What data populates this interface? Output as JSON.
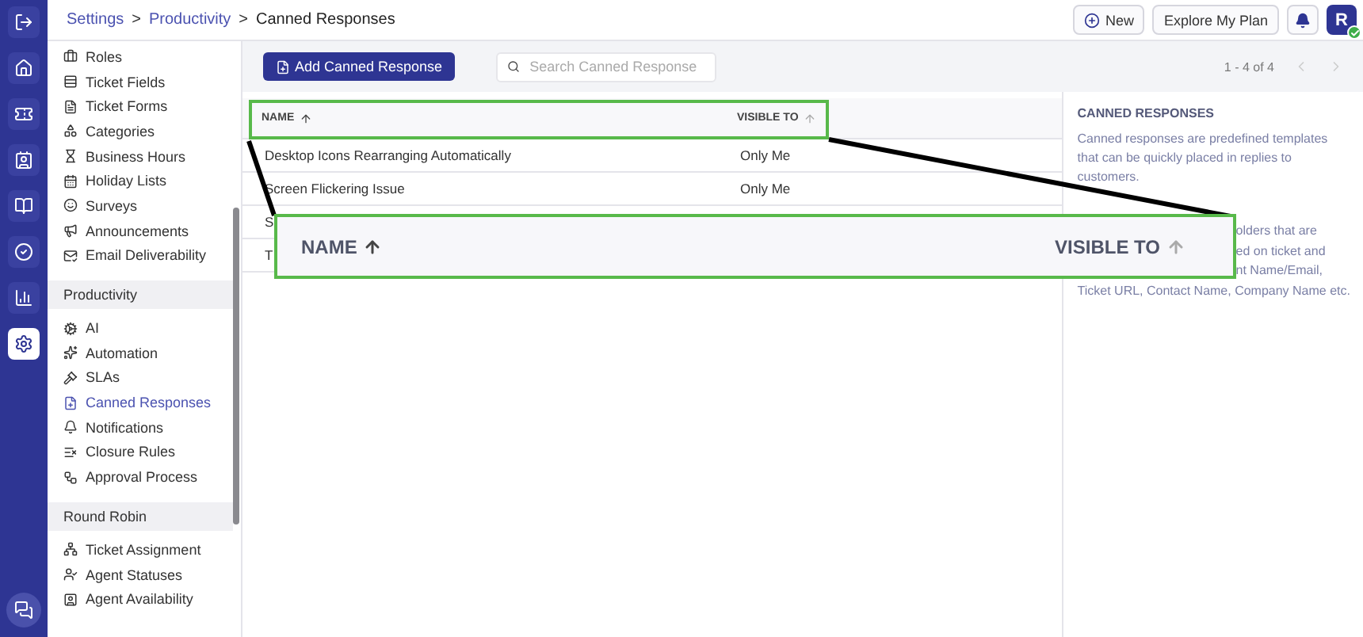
{
  "rail": [
    {
      "selected": false
    },
    {
      "selected": false
    },
    {
      "selected": false
    },
    {
      "selected": false
    },
    {
      "selected": false
    },
    {
      "selected": false
    },
    {
      "selected": false
    },
    {
      "selected": true
    }
  ],
  "breadcrumb": {
    "separator": ">",
    "items": [
      {
        "label": "Settings",
        "link": true
      },
      {
        "label": "Productivity",
        "link": true
      },
      {
        "label": "Canned Responses",
        "link": false
      }
    ]
  },
  "top_actions": {
    "new_button": "New",
    "plan_button": "Explore My Plan",
    "avatar": "R",
    "online": true
  },
  "sidebar": [
    {
      "items": [
        {
          "label": "Roles",
          "selected": false
        },
        {
          "label": "Ticket Fields",
          "selected": false
        },
        {
          "label": "Ticket Forms",
          "selected": false
        },
        {
          "label": "Categories",
          "selected": false
        },
        {
          "label": "Business Hours",
          "selected": false
        },
        {
          "label": "Holiday Lists",
          "selected": false
        },
        {
          "label": "Surveys",
          "selected": false
        },
        {
          "label": "Announcements",
          "selected": false
        },
        {
          "label": "Email Deliverability",
          "selected": false
        }
      ]
    },
    {
      "title": "Productivity",
      "items": [
        {
          "label": "AI",
          "selected": false
        },
        {
          "label": "Automation",
          "selected": false
        },
        {
          "label": "SLAs",
          "selected": false
        },
        {
          "label": "Canned Responses",
          "selected": true
        },
        {
          "label": "Notifications",
          "selected": false
        },
        {
          "label": "Closure Rules",
          "selected": false
        },
        {
          "label": "Approval Process",
          "selected": false
        }
      ]
    },
    {
      "title": "Round Robin",
      "items": [
        {
          "label": "Ticket Assignment",
          "selected": false
        },
        {
          "label": "Agent Statuses",
          "selected": false
        },
        {
          "label": "Agent Availability",
          "selected": false
        }
      ]
    }
  ],
  "toolbar": {
    "add_button": "Add Canned Response",
    "search": {
      "placeholder": "Search Canned Response"
    },
    "pagination": "1 - 4 of 4"
  },
  "table": {
    "columns": [
      {
        "label": "NAME",
        "sorted": true
      },
      {
        "label": "VISIBLE TO",
        "sorted": false
      }
    ],
    "rows": [
      {
        "name": "Desktop Icons Rearranging Automatically",
        "visible_to": "Only Me"
      },
      {
        "name": "Screen Flickering Issue",
        "visible_to": "Only Me"
      },
      {
        "name": "S"
      },
      {
        "name": "T"
      }
    ]
  },
  "help": {
    "title": "CANNED RESPONSES",
    "paragraph": "Canned responses are predefined templates that can be quickly placed in replies to customers.",
    "partial_lines": [
      "olders that are",
      "ed on ticket and",
      "nt Name/Email,",
      "Ticket URL, Contact Name, Company Name etc."
    ]
  },
  "callout": {
    "columns": [
      {
        "label": "NAME",
        "sorted": true
      },
      {
        "label": "VISIBLE TO",
        "sorted": false
      }
    ]
  }
}
